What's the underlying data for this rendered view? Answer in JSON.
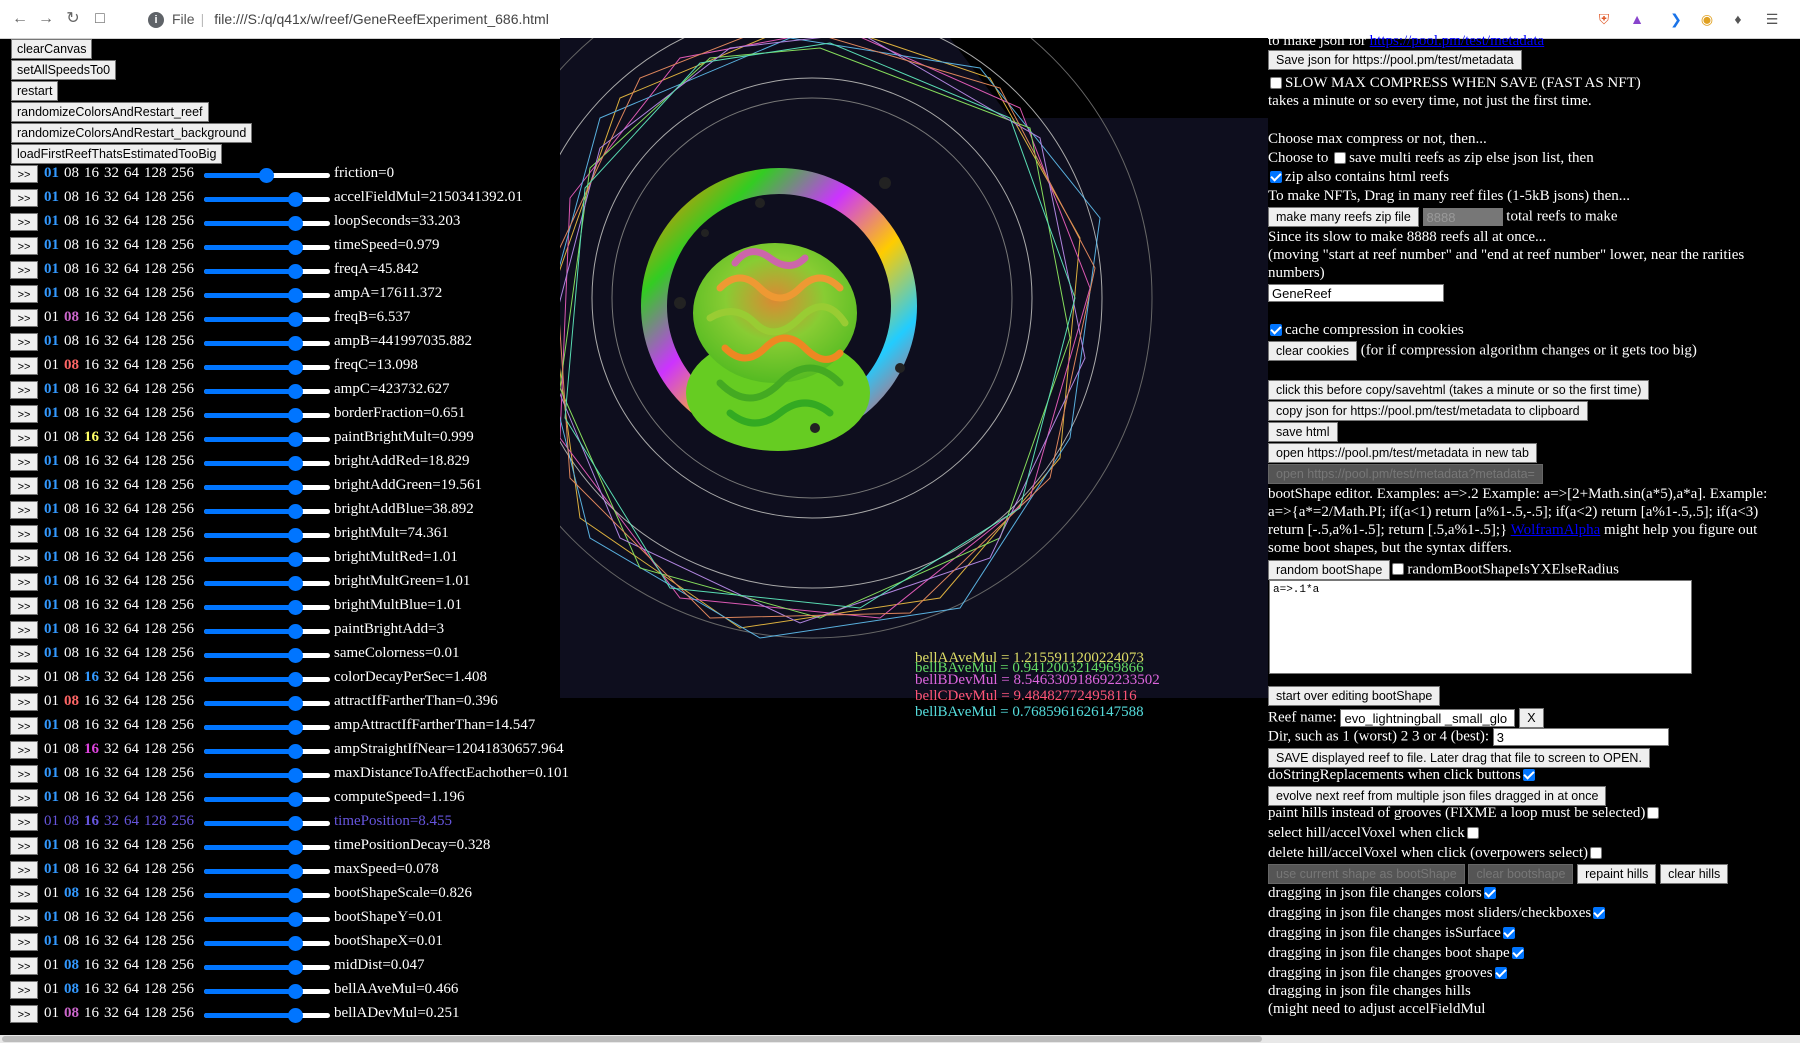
{
  "browser": {
    "file_label": "File",
    "url": "file:///S:/q/q41x/w/reef/GeneReefExperiment_686.html"
  },
  "top_buttons": [
    "clearCanvas",
    "setAllSpeedsTo0",
    "restart",
    "randomizeColorsAndRestart_reef",
    "randomizeColorsAndRestart_background",
    "loadFirstReefThatsEstimatedTooBig"
  ],
  "go_label": ">>",
  "sliders": [
    {
      "hl": 0,
      "hl_color": "#3399ff",
      "label": "friction=0",
      "level": 0.49,
      "row_color": "#ffffff"
    },
    {
      "hl": 0,
      "hl_color": "#3399ff",
      "label": "accelFieldMul=2150341392.01",
      "level": 0.72,
      "row_color": "#ffffff"
    },
    {
      "hl": 0,
      "hl_color": "#3399ff",
      "label": "loopSeconds=33.203",
      "level": 0.72,
      "row_color": "#ffffff"
    },
    {
      "hl": 0,
      "hl_color": "#3399ff",
      "label": "timeSpeed=0.979",
      "level": 0.72,
      "row_color": "#ffffff"
    },
    {
      "hl": 0,
      "hl_color": "#3399ff",
      "label": "freqA=45.842",
      "level": 0.72,
      "row_color": "#ffffff"
    },
    {
      "hl": 0,
      "hl_color": "#3399ff",
      "label": "ampA=17611.372",
      "level": 0.72,
      "row_color": "#ffffff"
    },
    {
      "hl": 1,
      "hl_color": "#cc66cc",
      "label": "freqB=6.537",
      "level": 0.72,
      "row_color": "#ffffff"
    },
    {
      "hl": 0,
      "hl_color": "#3399ff",
      "label": "ampB=441997035.882",
      "level": 0.72,
      "row_color": "#ffffff"
    },
    {
      "hl": 1,
      "hl_color": "#ff6666",
      "label": "freqC=13.098",
      "level": 0.72,
      "row_color": "#ffffff"
    },
    {
      "hl": 0,
      "hl_color": "#3399ff",
      "label": "ampC=423732.627",
      "level": 0.72,
      "row_color": "#ffffff"
    },
    {
      "hl": 0,
      "hl_color": "#3399ff",
      "label": "borderFraction=0.651",
      "level": 0.72,
      "row_color": "#ffffff"
    },
    {
      "hl": 2,
      "hl_color": "#ffff66",
      "label": "paintBrightMult=0.999",
      "level": 0.72,
      "row_color": "#ffffff"
    },
    {
      "hl": 0,
      "hl_color": "#3399ff",
      "label": "brightAddRed=18.829",
      "level": 0.72,
      "row_color": "#ffffff"
    },
    {
      "hl": 0,
      "hl_color": "#3399ff",
      "label": "brightAddGreen=19.561",
      "level": 0.72,
      "row_color": "#ffffff"
    },
    {
      "hl": 0,
      "hl_color": "#3399ff",
      "label": "brightAddBlue=38.892",
      "level": 0.72,
      "row_color": "#ffffff"
    },
    {
      "hl": 0,
      "hl_color": "#3399ff",
      "label": "brightMult=74.361",
      "level": 0.72,
      "row_color": "#ffffff"
    },
    {
      "hl": 0,
      "hl_color": "#3399ff",
      "label": "brightMultRed=1.01",
      "level": 0.72,
      "row_color": "#ffffff"
    },
    {
      "hl": 0,
      "hl_color": "#3399ff",
      "label": "brightMultGreen=1.01",
      "level": 0.72,
      "row_color": "#ffffff"
    },
    {
      "hl": 0,
      "hl_color": "#3399ff",
      "label": "brightMultBlue=1.01",
      "level": 0.72,
      "row_color": "#ffffff"
    },
    {
      "hl": 0,
      "hl_color": "#3399ff",
      "label": "paintBrightAdd=3",
      "level": 0.72,
      "row_color": "#ffffff"
    },
    {
      "hl": 0,
      "hl_color": "#3399ff",
      "label": "sameColorness=0.01",
      "level": 0.72,
      "row_color": "#ffffff"
    },
    {
      "hl": 2,
      "hl_color": "#3399ff",
      "label": "colorDecayPerSec=1.408",
      "level": 0.72,
      "row_color": "#ffffff"
    },
    {
      "hl": 1,
      "hl_color": "#ff6666",
      "label": "attractIfFartherThan=0.396",
      "level": 0.72,
      "row_color": "#ffffff"
    },
    {
      "hl": 0,
      "hl_color": "#3399ff",
      "label": "ampAttractIfFartherThan=14.547",
      "level": 0.72,
      "row_color": "#ffffff"
    },
    {
      "hl": 2,
      "hl_color": "#dd44dd",
      "label": "ampStraightIfNear=12041830657.964",
      "level": 0.72,
      "row_color": "#ffffff"
    },
    {
      "hl": 0,
      "hl_color": "#3399ff",
      "label": "maxDistanceToAffectEachother=0.101",
      "level": 0.72,
      "row_color": "#ffffff"
    },
    {
      "hl": 0,
      "hl_color": "#3399ff",
      "label": "computeSpeed=1.196",
      "level": 0.72,
      "row_color": "#ffffff"
    },
    {
      "hl": 2,
      "hl_color": "#6655dd",
      "label": "timePosition=8.455",
      "level": 0.72,
      "row_color": "#6655dd"
    },
    {
      "hl": 0,
      "hl_color": "#3399ff",
      "label": "timePositionDecay=0.328",
      "level": 0.72,
      "row_color": "#ffffff"
    },
    {
      "hl": 0,
      "hl_color": "#3399ff",
      "label": "maxSpeed=0.078",
      "level": 0.72,
      "row_color": "#ffffff"
    },
    {
      "hl": 1,
      "hl_color": "#3399ff",
      "label": "bootShapeScale=0.826",
      "level": 0.72,
      "row_color": "#ffffff"
    },
    {
      "hl": 0,
      "hl_color": "#3399ff",
      "label": "bootShapeY=0.01",
      "level": 0.72,
      "row_color": "#ffffff"
    },
    {
      "hl": 0,
      "hl_color": "#3399ff",
      "label": "bootShapeX=0.01",
      "level": 0.72,
      "row_color": "#ffffff"
    },
    {
      "hl": 1,
      "hl_color": "#3399ff",
      "label": "midDist=0.047",
      "level": 0.72,
      "row_color": "#ffffff"
    },
    {
      "hl": 1,
      "hl_color": "#3399ff",
      "label": "bellAAveMul=0.466",
      "level": 0.72,
      "row_color": "#ffffff"
    },
    {
      "hl": 1,
      "hl_color": "#cc66cc",
      "label": "bellADevMul=0.251",
      "level": 0.72,
      "row_color": "#ffffff"
    }
  ],
  "bits": [
    "01",
    "08",
    "16",
    "32",
    "64",
    "128",
    "256"
  ],
  "overlay": [
    {
      "text": "bellAAveMul = 1.2155911200224073",
      "color": "#dddd66"
    },
    {
      "text": "bellBAveMul = 0.9412003214969866",
      "color": "#66dd66"
    },
    {
      "text": "bellBDevMul = 8.546330918692233502",
      "color": "#dd66dd"
    },
    {
      "text": "bellCDevMul = 9.484827724958116",
      "color": "#ff5577"
    },
    {
      "text": "bellBAveMul = 0.7685961626147588",
      "color": "#55dddd"
    }
  ],
  "right": {
    "make_json_prefix": "to make json for ",
    "pool_link": "https://pool.pm/test/metadata",
    "save_json_btn": "Save json for  https://pool.pm/test/metadata",
    "slow_max": "SLOW MAX COMPRESS WHEN SAVE (FAST AS NFT)",
    "takes_minute": "takes a minute or so every time, not just the first time.",
    "choose_max": "Choose max compress or not, then...",
    "choose_to": "Choose to ",
    "save_multi": "save multi reefs as zip else json list, then",
    "zip_html": "zip also contains html reefs",
    "to_make_nfts": "To make NFTs, Drag in many reef files (1-5kB jsons) then...",
    "make_zip_btn": "make many reefs zip file",
    "total_reefs_value": "8888",
    "total_reefs_label": " total reefs to make",
    "since_slow": "Since its slow to make 8888 reefs all at once...",
    "moving_start": "(moving \"start at reef number\" and \"end at reef number\" lower, near the rarities",
    "numbers": "numbers)",
    "genereef_value": "GeneReef",
    "cache_compression": "cache compression in cookies",
    "clear_cookies_btn": "clear cookies",
    "clear_cookies_note": " (for if compression algorithm changes or it gets too big)",
    "click_before_btn": "click this before copy/savehtml (takes a minute or so the first time)",
    "copy_json_btn": "copy json for https://pool.pm/test/metadata to clipboard",
    "save_html_btn": "save html",
    "open_tab_btn": "open https://pool.pm/test/metadata in new tab",
    "open_meta_btn": "open https://pool.pm/test/metadata?metadata=",
    "bootshape_l1": "bootShape editor. Examples: a=>.2 Example: a=>[2+Math.sin(a*5),a*a]. Example:",
    "bootshape_l2": "a=>{a*=2/Math.PI; if(a<1) return [a%1-.5,-.5]; if(a<2) return [a%1-.5,.5]; if(a<3)",
    "bootshape_l3a": "return [-.5,a%1-.5]; return [.5,a%1-.5];} ",
    "wolfram": "WolframAlpha",
    "bootshape_l3b": " might help you figure out",
    "bootshape_l4": "some boot shapes, but the syntax differs.",
    "random_boot_btn": "random bootShape",
    "random_boot_cb": "randomBootShapeIsYXElseRadius",
    "bootshape_code": "a=>.1*a",
    "start_over_btn": "start over editing bootShape",
    "reef_name_label": "Reef name: ",
    "reef_name_value": "evo_lightningball _small_glo",
    "x_btn": "X",
    "dir_label": "Dir, such as 1 (worst) 2 3 or 4 (best): ",
    "dir_value": "3",
    "save_displayed_btn": "SAVE displayed reef to file. Later drag that file to screen to OPEN.",
    "do_string": "doStringReplacements when click buttons",
    "evolve_btn": "evolve next reef from multiple json files dragged in at once",
    "paint_hills": "paint hills instead of grooves (FIXME a loop must be selected)",
    "select_hill": "select hill/accelVoxel when click",
    "delete_hill": "delete hill/accelVoxel when click (overpowers select)",
    "use_current_btn": "use current shape as bootShape",
    "clear_bootshape_btn": "clear bootshape",
    "repaint_hills_btn": "repaint hills",
    "clear_hills_btn": "clear hills",
    "drag_colors": "dragging in json file changes colors",
    "drag_sliders": "dragging in json file changes most sliders/checkboxes",
    "drag_surface": "dragging in json file changes isSurface",
    "drag_boot": "dragging in json file changes boot shape",
    "drag_grooves": "dragging in json file changes grooves",
    "drag_hills": "dragging in json file changes hills",
    "might_need": "(might need to adjust accelFieldMul"
  }
}
